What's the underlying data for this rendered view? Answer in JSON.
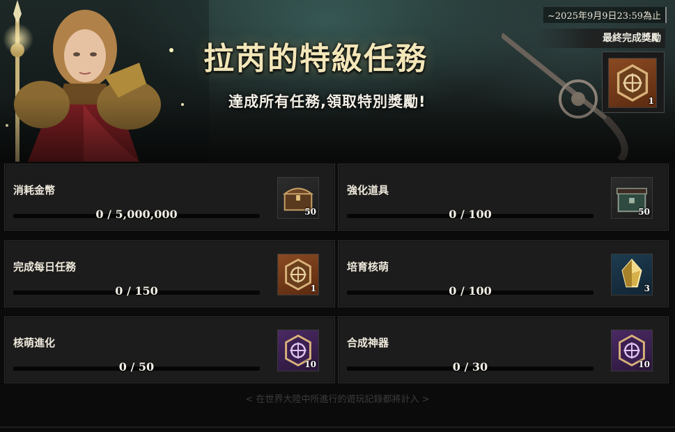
{
  "banner": {
    "title": "拉芮的特級任務",
    "subtitle": "達成所有任務,領取特別獎勵!",
    "deadline": "~2025年9月9日23:59為止",
    "final_reward_label": "最終完成獎勵",
    "final_reward": {
      "icon": "bronze-sigil-icon",
      "qty": "1"
    }
  },
  "quests": [
    {
      "name": "消耗金幣",
      "progress": "0 / 5,000,000",
      "fraction": 0,
      "reward": {
        "icon": "treasure-chest-icon",
        "qty": "50"
      }
    },
    {
      "name": "強化道具",
      "progress": "0 / 100",
      "fraction": 0,
      "reward": {
        "icon": "green-chest-icon",
        "qty": "50"
      }
    },
    {
      "name": "完成每日任務",
      "progress": "0 / 150",
      "fraction": 0,
      "reward": {
        "icon": "bronze-sigil-icon",
        "qty": "1"
      }
    },
    {
      "name": "培育核萌",
      "progress": "0 / 100",
      "fraction": 0,
      "reward": {
        "icon": "gold-crystal-icon",
        "qty": "3"
      }
    },
    {
      "name": "核萌進化",
      "progress": "0 / 50",
      "fraction": 0,
      "reward": {
        "icon": "purple-sigil-icon",
        "qty": "10"
      }
    },
    {
      "name": "合成神器",
      "progress": "0 / 30",
      "fraction": 0,
      "reward": {
        "icon": "purple-sigil-icon",
        "qty": "10"
      }
    }
  ],
  "footer": "< 在世界大陸中所進行的遊玩記錄都將計入 >"
}
